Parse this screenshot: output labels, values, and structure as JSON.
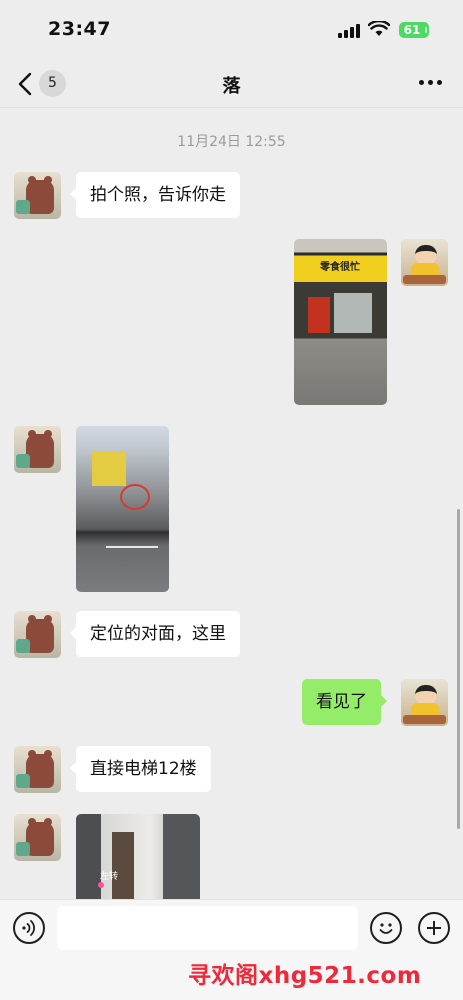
{
  "status_bar": {
    "time": "23:47",
    "battery": "61"
  },
  "nav": {
    "title": "落",
    "unread_count": "5"
  },
  "chat": {
    "timestamp": "11月24日 12:55",
    "messages": [
      {
        "side": "left",
        "type": "text",
        "text": "拍个照，告诉你走"
      },
      {
        "side": "right",
        "type": "image",
        "sign_text": "零食很忙"
      },
      {
        "side": "left",
        "type": "image"
      },
      {
        "side": "left",
        "type": "text",
        "text": "定位的对面，这里"
      },
      {
        "side": "right",
        "type": "text",
        "text": "看见了"
      },
      {
        "side": "left",
        "type": "text",
        "text": "直接电梯12楼"
      },
      {
        "side": "left",
        "type": "image",
        "label": "左转"
      }
    ]
  },
  "input": {
    "placeholder": ""
  },
  "watermark": "寻欢阁xhg521.com",
  "colors": {
    "background": "#ededed",
    "sent_bubble": "#95ec69",
    "received_bubble": "#ffffff",
    "battery": "#4cd964",
    "watermark": "#ee2a3a"
  }
}
